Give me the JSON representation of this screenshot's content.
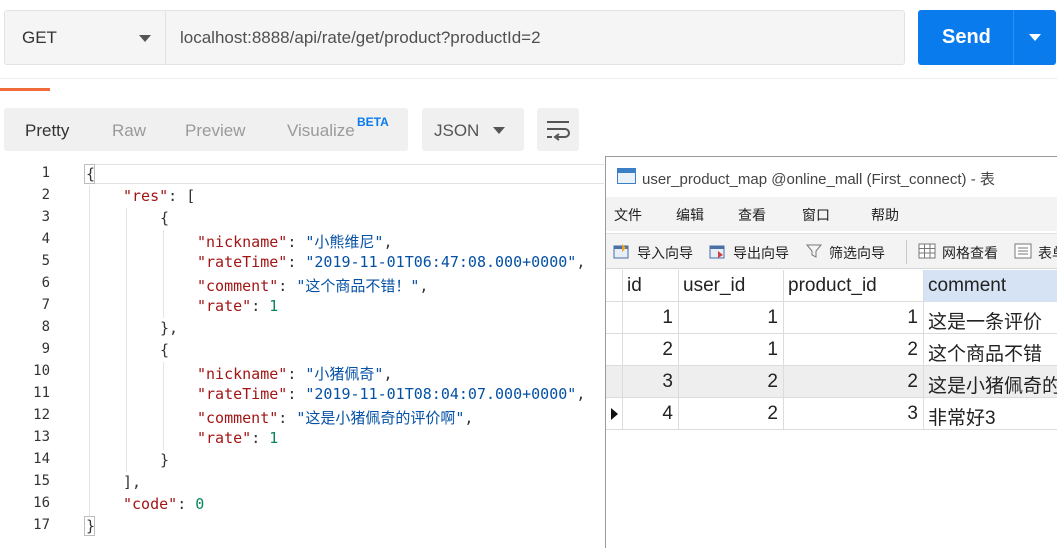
{
  "request": {
    "method": "GET",
    "url": "localhost:8888/api/rate/get/product?productId=2",
    "send_label": "Send"
  },
  "response_toolbar": {
    "tabs": [
      "Pretty",
      "Raw",
      "Preview",
      "Visualize"
    ],
    "beta_badge": "BETA",
    "active_tab": "Pretty",
    "format": "JSON"
  },
  "code": {
    "line_numbers": [
      "1",
      "2",
      "3",
      "4",
      "5",
      "6",
      "7",
      "8",
      "9",
      "10",
      "11",
      "12",
      "13",
      "14",
      "15",
      "16",
      "17"
    ],
    "lines": [
      {
        "indent": 0,
        "parts": [
          {
            "t": "p",
            "v": "{"
          }
        ]
      },
      {
        "indent": 1,
        "parts": [
          {
            "t": "k",
            "v": "\"res\""
          },
          {
            "t": "p",
            "v": ": ["
          }
        ]
      },
      {
        "indent": 2,
        "parts": [
          {
            "t": "p",
            "v": "{"
          }
        ]
      },
      {
        "indent": 3,
        "parts": [
          {
            "t": "k",
            "v": "\"nickname\""
          },
          {
            "t": "p",
            "v": ": "
          },
          {
            "t": "s",
            "v": "\"小熊维尼\""
          },
          {
            "t": "p",
            "v": ","
          }
        ]
      },
      {
        "indent": 3,
        "parts": [
          {
            "t": "k",
            "v": "\"rateTime\""
          },
          {
            "t": "p",
            "v": ": "
          },
          {
            "t": "s",
            "v": "\"2019-11-01T06:47:08.000+0000\""
          },
          {
            "t": "p",
            "v": ","
          }
        ]
      },
      {
        "indent": 3,
        "parts": [
          {
            "t": "k",
            "v": "\"comment\""
          },
          {
            "t": "p",
            "v": ": "
          },
          {
            "t": "s",
            "v": "\"这个商品不错！\""
          },
          {
            "t": "p",
            "v": ","
          }
        ]
      },
      {
        "indent": 3,
        "parts": [
          {
            "t": "k",
            "v": "\"rate\""
          },
          {
            "t": "p",
            "v": ": "
          },
          {
            "t": "n",
            "v": "1"
          }
        ]
      },
      {
        "indent": 2,
        "parts": [
          {
            "t": "p",
            "v": "},"
          }
        ]
      },
      {
        "indent": 2,
        "parts": [
          {
            "t": "p",
            "v": "{"
          }
        ]
      },
      {
        "indent": 3,
        "parts": [
          {
            "t": "k",
            "v": "\"nickname\""
          },
          {
            "t": "p",
            "v": ": "
          },
          {
            "t": "s",
            "v": "\"小猪佩奇\""
          },
          {
            "t": "p",
            "v": ","
          }
        ]
      },
      {
        "indent": 3,
        "parts": [
          {
            "t": "k",
            "v": "\"rateTime\""
          },
          {
            "t": "p",
            "v": ": "
          },
          {
            "t": "s",
            "v": "\"2019-11-01T08:04:07.000+0000\""
          },
          {
            "t": "p",
            "v": ","
          }
        ]
      },
      {
        "indent": 3,
        "parts": [
          {
            "t": "k",
            "v": "\"comment\""
          },
          {
            "t": "p",
            "v": ": "
          },
          {
            "t": "s",
            "v": "\"这是小猪佩奇的评价啊\""
          },
          {
            "t": "p",
            "v": ","
          }
        ]
      },
      {
        "indent": 3,
        "parts": [
          {
            "t": "k",
            "v": "\"rate\""
          },
          {
            "t": "p",
            "v": ": "
          },
          {
            "t": "n",
            "v": "1"
          }
        ]
      },
      {
        "indent": 2,
        "parts": [
          {
            "t": "p",
            "v": "}"
          }
        ]
      },
      {
        "indent": 1,
        "parts": [
          {
            "t": "p",
            "v": "],"
          }
        ]
      },
      {
        "indent": 1,
        "parts": [
          {
            "t": "k",
            "v": "\"code\""
          },
          {
            "t": "p",
            "v": ": "
          },
          {
            "t": "n",
            "v": "0"
          }
        ]
      },
      {
        "indent": 0,
        "parts": [
          {
            "t": "p",
            "v": "}"
          }
        ]
      }
    ]
  },
  "navicat": {
    "title": "user_product_map @online_mall (First_connect) - 表",
    "menu": [
      "文件",
      "编辑",
      "查看",
      "窗口",
      "帮助"
    ],
    "tools": [
      {
        "label": "导入向导",
        "icon": "import-wizard-icon"
      },
      {
        "label": "导出向导",
        "icon": "export-wizard-icon"
      },
      {
        "label": "筛选向导",
        "icon": "filter-wizard-icon"
      },
      {
        "label": "网格查看",
        "icon": "grid-view-icon"
      },
      {
        "label": "表单",
        "icon": "form-view-icon"
      }
    ],
    "columns": [
      "id",
      "user_id",
      "product_id",
      "comment"
    ],
    "selected_column": "comment",
    "rows": [
      [
        "1",
        "1",
        "1",
        "这是一条评价"
      ],
      [
        "2",
        "1",
        "2",
        "这个商品不错"
      ],
      [
        "3",
        "2",
        "2",
        "这是小猪佩奇的"
      ],
      [
        "4",
        "2",
        "3",
        "非常好3"
      ]
    ],
    "current_row": 3
  },
  "colors": {
    "send": "#097bed",
    "json_key": "#a31515",
    "json_string": "#0451a5",
    "json_number": "#098658",
    "tab_accent": "#f26b3a",
    "selected_header": "#d5e3f4"
  }
}
